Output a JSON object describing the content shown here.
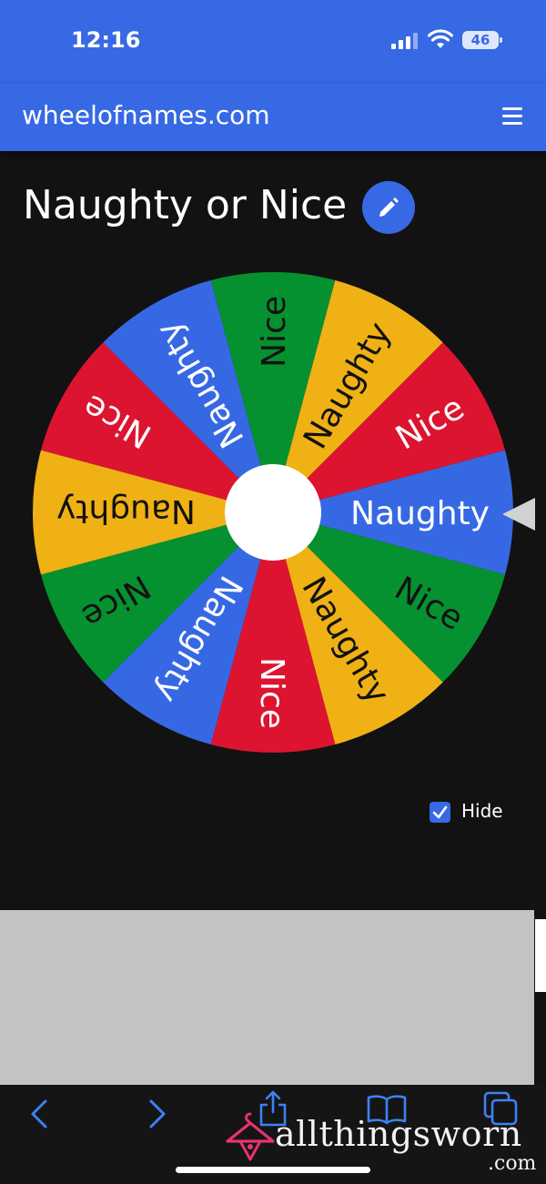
{
  "status_bar": {
    "time": "12:16",
    "battery": "46",
    "icons": [
      "cellular-signal-icon",
      "wifi-icon",
      "battery-icon"
    ]
  },
  "header": {
    "site_name": "wheelofnames.com",
    "menu_icon": "hamburger-menu-icon"
  },
  "wheel": {
    "title": "Naughty or Nice",
    "edit_icon": "pencil-icon",
    "segments": [
      {
        "label": "Nice",
        "color": "#069130"
      },
      {
        "label": "Naughty",
        "color": "#f0b114"
      },
      {
        "label": "Nice",
        "color": "#dc1430"
      },
      {
        "label": "Naughty",
        "color": "#3768e4"
      },
      {
        "label": "Nice",
        "color": "#069130"
      },
      {
        "label": "Naughty",
        "color": "#f0b114"
      },
      {
        "label": "Nice",
        "color": "#dc1430"
      },
      {
        "label": "Naughty",
        "color": "#3768e4"
      },
      {
        "label": "Nice",
        "color": "#069130"
      },
      {
        "label": "Naughty",
        "color": "#f0b114"
      },
      {
        "label": "Nice",
        "color": "#dc1430"
      },
      {
        "label": "Naughty",
        "color": "#3768e4"
      }
    ],
    "pointer_icon": "triangle-pointer-icon"
  },
  "options": {
    "hide_label": "Hide",
    "hide_checked": true
  },
  "browser_toolbar": {
    "icons": [
      "back-icon",
      "forward-icon",
      "share-icon",
      "bookmarks-icon",
      "tabs-icon"
    ]
  },
  "watermark": {
    "text": "allthingsworn",
    "suffix": ".com",
    "color": "#e8336d"
  },
  "colors": {
    "brand_blue": "#3769e4",
    "background": "#121212",
    "panel_grey": "#c3c3c3"
  }
}
